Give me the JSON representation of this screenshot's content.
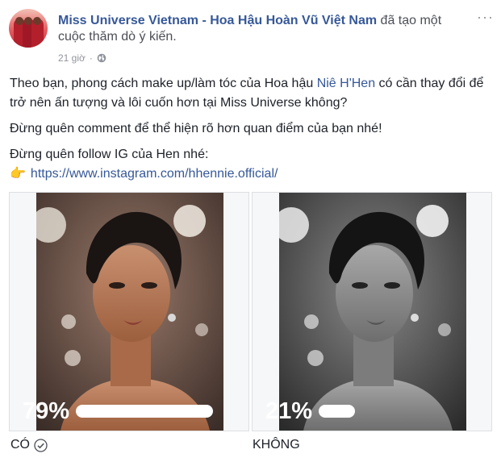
{
  "post": {
    "author": "Miss Universe Vietnam - Hoa Hậu Hoàn Vũ Việt Nam",
    "action": "đã tạo một cuộc thăm dò ý kiến.",
    "time": "21 giờ",
    "separator": "·",
    "audience_icon": "globe-icon",
    "more_icon": "more-options-icon",
    "more_label": "···"
  },
  "body": {
    "question_before": "Theo bạn, phong cách make up/làm tóc của Hoa hậu ",
    "question_link": "Niê H'Hen",
    "question_after": " có cần thay đổi để trở nên ấn tượng và lôi cuốn hơn tại Miss Universe không?",
    "line2": "Đừng quên comment để thể hiện rõ hơn quan điểm của bạn nhé!",
    "line3": "Đừng quên follow IG của Hen nhé:",
    "hand_icon": "pointing-hand-icon",
    "hand_glyph": "👉",
    "url": "https://www.instagram.com/hhennie.official/"
  },
  "poll": {
    "options": [
      {
        "percent_label": "79%",
        "percent": 79,
        "label": "CÓ",
        "voted": true,
        "image_style": "color"
      },
      {
        "percent_label": "21%",
        "percent": 21,
        "label": "KHÔNG",
        "voted": false,
        "image_style": "grayscale"
      }
    ]
  },
  "colors": {
    "link": "#365899",
    "text": "#1d2129",
    "meta": "#90949c"
  }
}
